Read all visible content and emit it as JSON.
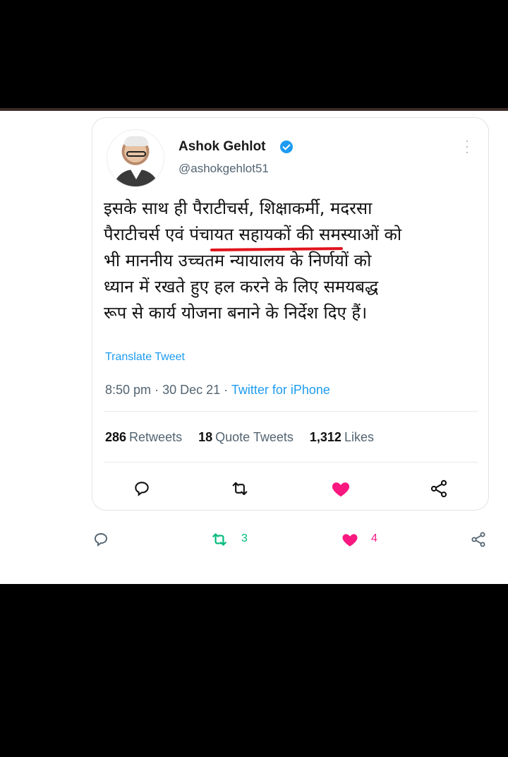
{
  "tweet": {
    "name": "Ashok Gehlot",
    "handle": "@ashokgehlot51",
    "text": "इसके साथ ही पैराटीचर्स, शिक्षाकर्मी, मदरसा\nपैराटीचर्स एवं पंचायत सहायकों की समस्याओं को\nभी माननीय उच्चतम न्यायालय के निर्णयों को\nध्यान में रखते हुए हल करने के लिए समयबद्ध\nरूप से कार्य योजना बनाने के निर्देश दिए हैं।",
    "translate_label": "Translate Tweet",
    "time": "8:50 pm",
    "date": "30 Dec 21",
    "source": "Twitter for iPhone",
    "retweets_count": "286",
    "retweets_label": "Retweets",
    "quotes_count": "18",
    "quotes_label": "Quote Tweets",
    "likes_count": "1,312",
    "likes_label": "Likes"
  },
  "post_actions": {
    "retweet_count": "3",
    "like_count": "4"
  },
  "colors": {
    "accent": "#1d9bf0",
    "like": "#f91880",
    "retweet": "#00ba7c",
    "underline": "#e0141c"
  }
}
